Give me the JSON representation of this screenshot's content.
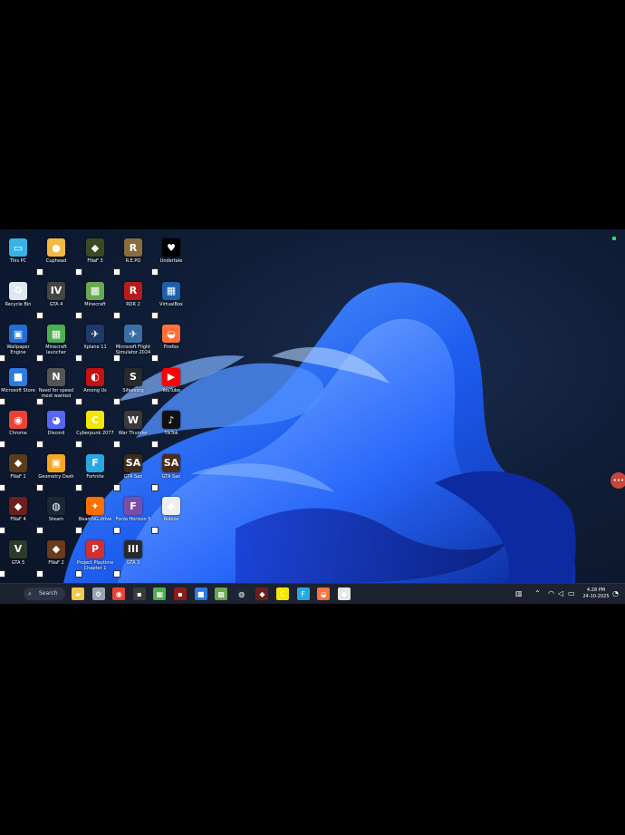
{
  "desktop_icons": [
    {
      "label": "This PC",
      "icon": "monitor-icon",
      "color": "#37b3ea",
      "glyph": "▭"
    },
    {
      "label": "Recycle Bin",
      "icon": "recycle-bin-icon",
      "color": "#dfe7f0",
      "glyph": "♻"
    },
    {
      "label": "Wallpaper Engine",
      "icon": "wallpaper-engine-icon",
      "color": "#1f6fd6",
      "glyph": "▣"
    },
    {
      "label": "Microsoft Store",
      "icon": "store-icon",
      "color": "#2c7be5",
      "glyph": "■"
    },
    {
      "label": "Chrome",
      "icon": "chrome-icon",
      "color": "#ea4335",
      "glyph": "◉"
    },
    {
      "label": "FNaF 1",
      "icon": "fnaf-icon",
      "color": "#5a3b1c",
      "glyph": "◆"
    },
    {
      "label": "FNaF 4",
      "icon": "fnaf4-icon",
      "color": "#6b1f1f",
      "glyph": "◆"
    },
    {
      "label": "GTA 5",
      "icon": "gta5-icon",
      "color": "#2d3a2a",
      "glyph": "V"
    },
    {
      "label": "Cuphead",
      "icon": "cuphead-icon",
      "color": "#f4b942",
      "glyph": "●"
    },
    {
      "label": "GTA 4",
      "icon": "gta4-icon",
      "color": "#444",
      "glyph": "IV"
    },
    {
      "label": "Minecraft launcher",
      "icon": "creeper-icon",
      "color": "#4caf50",
      "glyph": "▦"
    },
    {
      "label": "Need for speed most wanted",
      "icon": "nfs-icon",
      "color": "#555",
      "glyph": "N"
    },
    {
      "label": "Discord",
      "icon": "discord-icon",
      "color": "#5865f2",
      "glyph": "◕"
    },
    {
      "label": "Geometry Dash",
      "icon": "geometry-dash-icon",
      "color": "#f5a623",
      "glyph": "▣"
    },
    {
      "label": "Steam",
      "icon": "steam-icon",
      "color": "#1b2838",
      "glyph": "◍"
    },
    {
      "label": "FNaF 2",
      "icon": "fnaf2-icon",
      "color": "#6a3b1a",
      "glyph": "◆"
    },
    {
      "label": "FNaF 3",
      "icon": "fnaf3-icon",
      "color": "#3b4a22",
      "glyph": "◆"
    },
    {
      "label": "Minecraft",
      "icon": "grass-block-icon",
      "color": "#6aa84f",
      "glyph": "▩"
    },
    {
      "label": "Xplane 11",
      "icon": "xplane-icon",
      "color": "#1e3a6b",
      "glyph": "✈"
    },
    {
      "label": "Among Us",
      "icon": "among-us-icon",
      "color": "#c51111",
      "glyph": "◐"
    },
    {
      "label": "Cyberpunk 2077",
      "icon": "cyberpunk-icon",
      "color": "#f3e600",
      "glyph": "C"
    },
    {
      "label": "Fortnite",
      "icon": "fortnite-icon",
      "color": "#29a8e0",
      "glyph": "F"
    },
    {
      "label": "BeamNG.drive",
      "icon": "beamng-icon",
      "color": "#ff6f00",
      "glyph": "✦"
    },
    {
      "label": "Project Playtime Chapter 1",
      "icon": "playtime-icon",
      "color": "#d32f2f",
      "glyph": "P"
    },
    {
      "label": "R.E.PO",
      "icon": "repo-icon",
      "color": "#8a6d3b",
      "glyph": "R"
    },
    {
      "label": "RDR 2",
      "icon": "rdr2-icon",
      "color": "#b71c1c",
      "glyph": "R"
    },
    {
      "label": "Microsoft Flight Simulator 2024",
      "icon": "flight-sim-icon",
      "color": "#3b6ea5",
      "glyph": "✈"
    },
    {
      "label": "Sifeesorg",
      "icon": "sifeesorg-icon",
      "color": "#2a2a2a",
      "glyph": "S"
    },
    {
      "label": "War Thunder",
      "icon": "war-thunder-icon",
      "color": "#3a3a3a",
      "glyph": "W"
    },
    {
      "label": "GTA San",
      "icon": "gta-sa-icon",
      "color": "#3b2c1a",
      "glyph": "SA"
    },
    {
      "label": "Forza Horizon 5",
      "icon": "forza-icon",
      "color": "#7a4ea8",
      "glyph": "F"
    },
    {
      "label": "GTA 3",
      "icon": "gta3-icon",
      "color": "#2a2a2a",
      "glyph": "III"
    },
    {
      "label": "Undertale",
      "icon": "heart-icon",
      "color": "#000000",
      "glyph": "♥"
    },
    {
      "label": "VirtualBox",
      "icon": "virtualbox-icon",
      "color": "#1f5fa8",
      "glyph": "▦"
    },
    {
      "label": "Firefox",
      "icon": "firefox-icon",
      "color": "#ff7139",
      "glyph": "◒"
    },
    {
      "label": "YouTube",
      "icon": "youtube-icon",
      "color": "#ff0000",
      "glyph": "▶"
    },
    {
      "label": "TikTok",
      "icon": "tiktok-icon",
      "color": "#111111",
      "glyph": "♪"
    },
    {
      "label": "GTA San",
      "icon": "gta-san-icon",
      "color": "#4a2d1a",
      "glyph": "SA"
    },
    {
      "label": "Roblox",
      "icon": "roblox-icon",
      "color": "#eeeeee",
      "glyph": "◆"
    }
  ],
  "taskbar": {
    "search_placeholder": "Search",
    "pinned": [
      {
        "icon": "file-explorer-icon",
        "color": "#f2c94c",
        "glyph": "▰"
      },
      {
        "icon": "settings-icon",
        "color": "#9aa3b2",
        "glyph": "⚙"
      },
      {
        "icon": "chrome-icon",
        "color": "#ea4335",
        "glyph": "◉"
      },
      {
        "icon": "game-icon",
        "color": "#3a3a3a",
        "glyph": "▪"
      },
      {
        "icon": "minecraft-launcher-icon",
        "color": "#4caf50",
        "glyph": "▦"
      },
      {
        "icon": "rdr2-icon",
        "color": "#8b1c1c",
        "glyph": "▪"
      },
      {
        "icon": "store-icon",
        "color": "#2c7be5",
        "glyph": "■"
      },
      {
        "icon": "minecraft-icon",
        "color": "#6aa84f",
        "glyph": "▩"
      },
      {
        "icon": "steam-icon",
        "color": "#1b2838",
        "glyph": "◍"
      },
      {
        "icon": "fnaf-icon",
        "color": "#6b1f1f",
        "glyph": "◆"
      },
      {
        "icon": "cyberpunk-icon",
        "color": "#f3e600",
        "glyph": "C"
      },
      {
        "icon": "fortnite-icon",
        "color": "#29a8e0",
        "glyph": "F"
      },
      {
        "icon": "firefox-icon",
        "color": "#ff7139",
        "glyph": "◒"
      },
      {
        "icon": "roblox-icon",
        "color": "#e6e6e6",
        "glyph": "◆"
      }
    ],
    "time": "4:28 PM",
    "date": "24-10-2025"
  },
  "overlay": {
    "handle_label": "•••"
  }
}
